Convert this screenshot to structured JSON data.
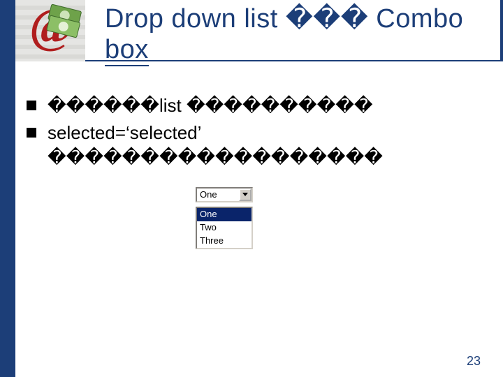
{
  "title_line1": "Drop down list ��� Combo",
  "title_line2": "box",
  "bullets": [
    "������list ����������",
    "selected=‘selected’\n������������������"
  ],
  "combo": {
    "closed_value": "One",
    "options": [
      "One",
      "Two",
      "Three"
    ],
    "selected_index": 0
  },
  "page_number": "23"
}
